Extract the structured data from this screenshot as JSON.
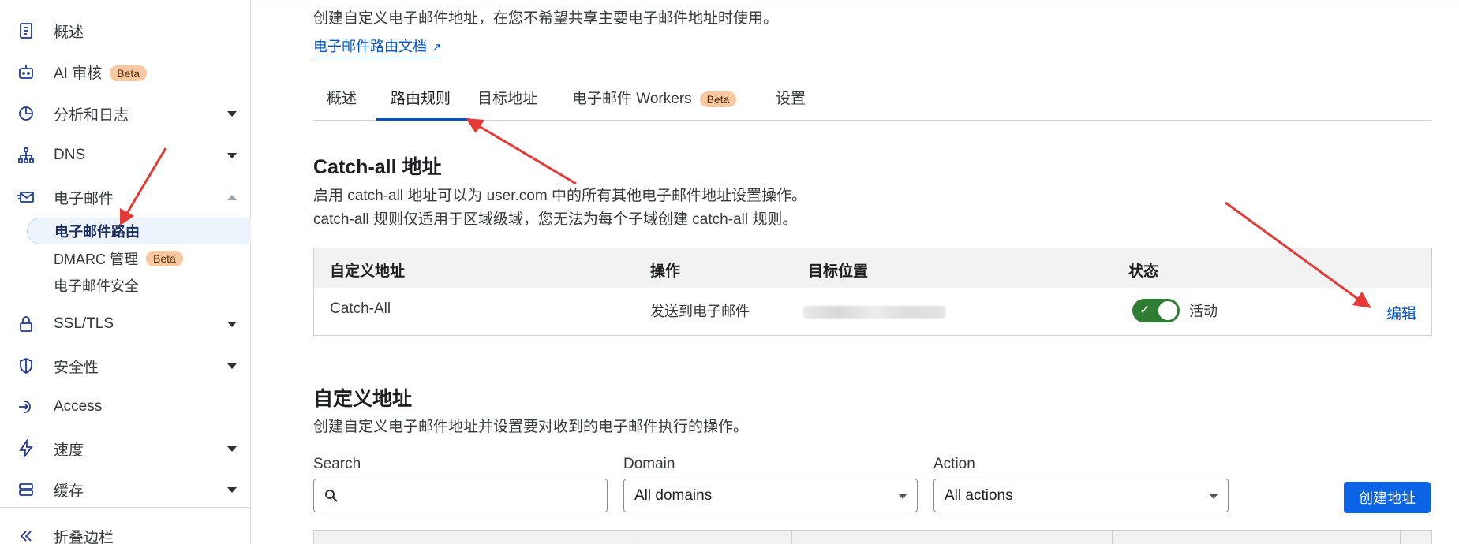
{
  "sidebar": {
    "items": [
      {
        "label": "概述",
        "icon": "document-icon"
      },
      {
        "label": "AI 审核",
        "badge": "Beta",
        "icon": "robot-icon"
      },
      {
        "label": "分析和日志",
        "icon": "chart-pie-icon"
      },
      {
        "label": "DNS",
        "icon": "network-icon"
      },
      {
        "label": "电子邮件",
        "icon": "mail-icon"
      },
      {
        "label": "SSL/TLS",
        "icon": "lock-icon"
      },
      {
        "label": "安全性",
        "icon": "shield-icon"
      },
      {
        "label": "Access",
        "icon": "access-icon"
      },
      {
        "label": "速度",
        "icon": "bolt-icon"
      },
      {
        "label": "缓存",
        "icon": "storage-icon"
      }
    ],
    "email_sub": [
      {
        "label": "电子邮件路由"
      },
      {
        "label": "DMARC 管理",
        "badge": "Beta"
      },
      {
        "label": "电子邮件安全"
      }
    ],
    "collapse_label": "折叠边栏"
  },
  "main": {
    "intro": "创建自定义电子邮件地址，在您不希望共享主要电子邮件地址时使用。",
    "doc_link": "电子邮件路由文档",
    "tabs": [
      {
        "label": "概述"
      },
      {
        "label": "路由规则"
      },
      {
        "label": "目标地址"
      },
      {
        "label": "电子邮件 Workers",
        "badge": "Beta"
      },
      {
        "label": "设置"
      }
    ],
    "catch_all": {
      "title": "Catch-all 地址",
      "desc_line1": "启用 catch-all 地址可以为 user.com 中的所有其他电子邮件地址设置操作。",
      "desc_line2": "catch-all 规则仅适用于区域级域，您无法为每个子域创建 catch-all 规则。",
      "headers": [
        "自定义地址",
        "操作",
        "目标位置",
        "状态"
      ],
      "row": {
        "address": "Catch-All",
        "action": "发送到电子邮件",
        "status": "活动",
        "edit": "编辑"
      }
    },
    "custom": {
      "title": "自定义地址",
      "desc": "创建自定义电子邮件地址并设置要对收到的电子邮件执行的操作。",
      "search_label": "Search",
      "domain_label": "Domain",
      "domain_value": "All domains",
      "action_label": "Action",
      "action_value": "All actions",
      "create_button": "创建地址"
    }
  },
  "colors": {
    "accent": "#0051c3",
    "button": "#0b63e5",
    "toggle_on": "#2e7d32",
    "beta_badge": "#f8c9a1",
    "annotation_arrow": "#e53935"
  }
}
